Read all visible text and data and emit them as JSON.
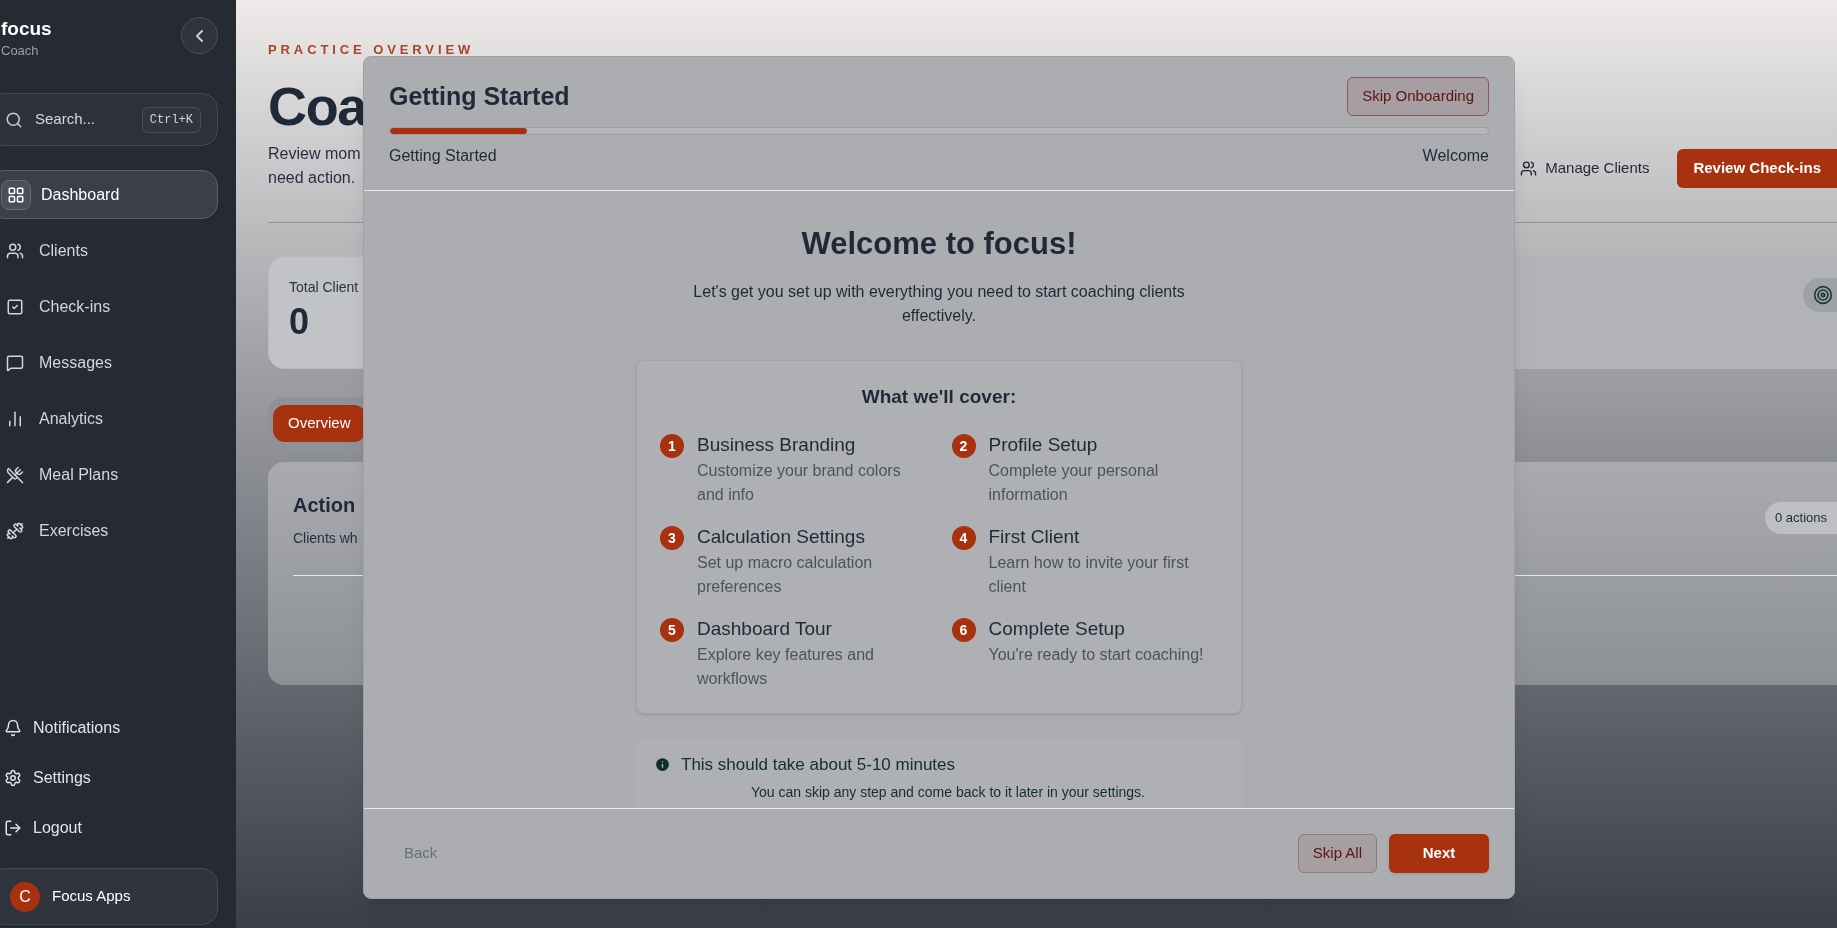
{
  "sidebar": {
    "logo": "focus",
    "subtitle": "Coach",
    "search": {
      "placeholder": "Search...",
      "shortcut": "Ctrl+K"
    },
    "nav": [
      {
        "label": "Dashboard",
        "selected": true
      },
      {
        "label": "Clients",
        "selected": false
      },
      {
        "label": "Check-ins",
        "selected": false
      },
      {
        "label": "Messages",
        "selected": false
      },
      {
        "label": "Analytics",
        "selected": false
      },
      {
        "label": "Meal Plans",
        "selected": false
      },
      {
        "label": "Exercises",
        "selected": false
      }
    ],
    "footer_links": [
      "Notifications",
      "Settings",
      "Logout"
    ],
    "profile": {
      "initial": "C",
      "name": "Focus Apps"
    }
  },
  "page": {
    "eyebrow": "PRACTICE OVERVIEW",
    "title": "Coa",
    "description_lines": [
      "Review mom",
      "need action."
    ],
    "actions": [
      {
        "label": "Manage Clients",
        "kind": "link"
      },
      {
        "label": "Review Check-ins",
        "kind": "primary"
      }
    ],
    "stats": [
      {
        "label": "Total Client",
        "value": "0"
      }
    ],
    "tabs": [
      {
        "label": "Overview",
        "selected": true
      }
    ],
    "action_queue": {
      "title": "Action",
      "subtitle": "Clients wh",
      "count": "0 actions"
    }
  },
  "modal": {
    "title": "Getting Started",
    "skip_button": "Skip Onboarding",
    "progress": {
      "level": 0.125,
      "current_step": "Getting Started",
      "next_step": "Welcome"
    },
    "heading": "Welcome to focus!",
    "intro": "Let's get you set up with everything you need to start coaching clients effectively.",
    "cover": {
      "title": "What we'll cover:",
      "items": [
        {
          "number": "1",
          "title": "Business Branding",
          "description": "Customize your brand colors and info"
        },
        {
          "number": "2",
          "title": "Profile Setup",
          "description": "Complete your personal information"
        },
        {
          "number": "3",
          "title": "Calculation Settings",
          "description": "Set up macro calculation preferences"
        },
        {
          "number": "4",
          "title": "First Client",
          "description": "Learn how to invite your first client"
        },
        {
          "number": "5",
          "title": "Dashboard Tour",
          "description": "Explore key features and workflows"
        },
        {
          "number": "6",
          "title": "Complete Setup",
          "description": "You're ready to start coaching!"
        }
      ]
    },
    "note": {
      "title": "This should take about 5-10 minutes",
      "text": "You can skip any step and come back to it later in your settings."
    },
    "footer": {
      "back": "Back",
      "skip_all": "Skip All",
      "next": "Next"
    }
  }
}
